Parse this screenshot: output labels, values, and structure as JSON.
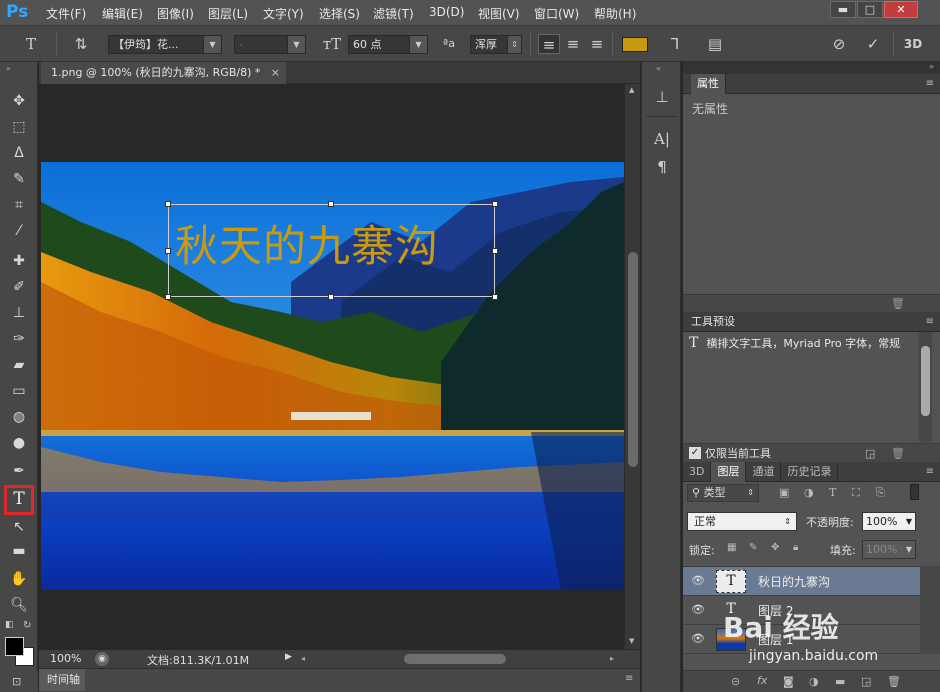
{
  "app": {
    "logo": "Ps"
  },
  "menu": [
    "文件(F)",
    "编辑(E)",
    "图像(I)",
    "图层(L)",
    "文字(Y)",
    "选择(S)",
    "滤镜(T)",
    "3D(D)",
    "视图(V)",
    "窗口(W)",
    "帮助(H)"
  ],
  "window_controls": {
    "minimize": "▬",
    "maximize": "□",
    "close": "✕"
  },
  "options": {
    "font_family": "【伊筠】花...",
    "font_style": "-",
    "font_size": "60 点",
    "aa_label": "ªa",
    "antialias": "浑厚",
    "text_color": "#c89a10",
    "cancel": "⃠",
    "commit": "✓",
    "threed": "3D"
  },
  "document": {
    "tab_title": "1.png @ 100% (秋日的九寨沟, RGB/8) *",
    "canvas_text": "秋天的九寨沟",
    "zoom": "100%",
    "doc_info": "文档:811.3K/1.01M",
    "timeline_label": "时间轴"
  },
  "panels": {
    "properties": {
      "title": "属性",
      "empty_text": "无属性"
    },
    "tool_presets": {
      "title": "工具预设",
      "item": "横排文字工具，Myriad Pro 字体，常规",
      "current_only_label": "仅限当前工具"
    },
    "layers": {
      "tabs": [
        "3D",
        "图层",
        "通道",
        "历史记录"
      ],
      "filter_kind": "类型",
      "blend_mode": "正常",
      "opacity_label": "不透明度:",
      "opacity_value": "100%",
      "lock_label": "锁定:",
      "fill_label": "填充:",
      "fill_value": "100%",
      "items": [
        {
          "name": "秋日的九寨沟",
          "kind": "T",
          "selected": true
        },
        {
          "name": "图层 2",
          "kind": "T",
          "selected": false
        },
        {
          "name": "图层 1",
          "kind": "img",
          "selected": false
        }
      ]
    }
  },
  "watermark": {
    "brand": "Bai 经验",
    "url": "jingyan.baidu.com"
  }
}
